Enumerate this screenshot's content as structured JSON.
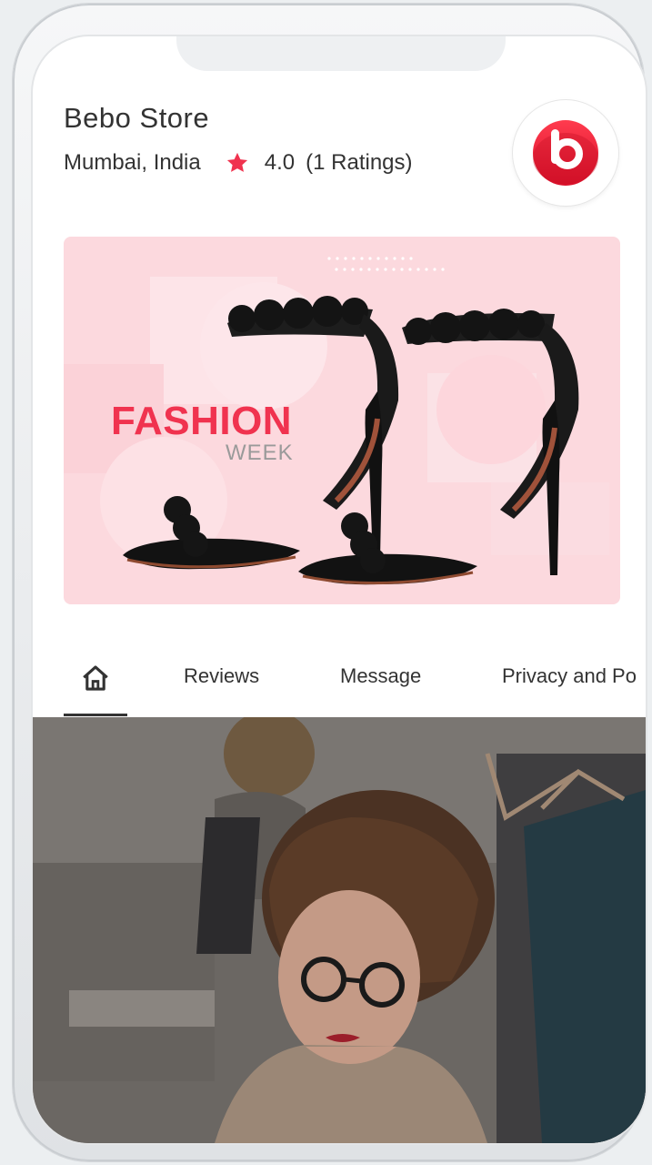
{
  "store": {
    "name": "Bebo Store",
    "location": "Mumbai, India",
    "rating": "4.0",
    "ratings_count": "(1 Ratings)",
    "logo_letter": "b"
  },
  "banner": {
    "title": "FASHION",
    "subtitle": "WEEK"
  },
  "tabs": {
    "home_icon": "home-icon",
    "reviews": "Reviews",
    "message": "Message",
    "privacy": "Privacy and Po"
  },
  "colors": {
    "accent": "#f0334f",
    "banner_bg": "#fcd9de",
    "logo_red": "#e8192c"
  }
}
